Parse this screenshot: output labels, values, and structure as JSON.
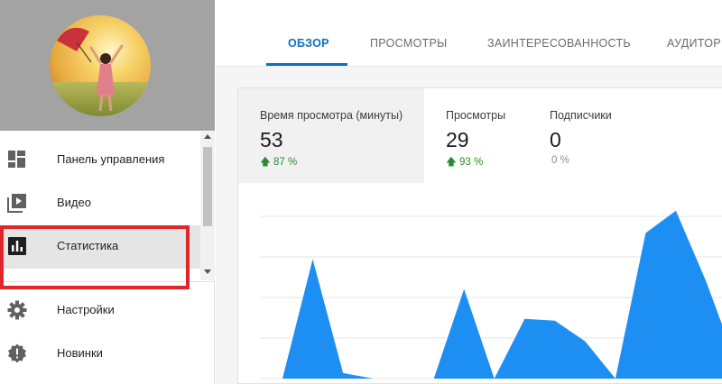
{
  "sidebar": {
    "items": [
      {
        "label": "Панель управления",
        "icon": "dashboard-icon"
      },
      {
        "label": "Видео",
        "icon": "video-library-icon"
      },
      {
        "label": "Статистика",
        "icon": "analytics-icon"
      },
      {
        "label": "Настройки",
        "icon": "gear-icon"
      },
      {
        "label": "Новинки",
        "icon": "alert-badge-icon"
      }
    ],
    "active_item": "Статистика"
  },
  "tabs": [
    {
      "label": "ОБЗОР"
    },
    {
      "label": "ПРОСМОТРЫ"
    },
    {
      "label": "ЗАИНТЕРЕСОВАННОСТЬ"
    },
    {
      "label": "АУДИТОР"
    }
  ],
  "metrics": [
    {
      "label": "Время просмотра (минуты)",
      "value": "53",
      "change": "87 %",
      "trend": "up"
    },
    {
      "label": "Просмотры",
      "value": "29",
      "change": "93 %",
      "trend": "up"
    },
    {
      "label": "Подписчики",
      "value": "0",
      "change": "0 %",
      "trend": "flat"
    }
  ],
  "colors": {
    "accent": "#0b6fc4",
    "chart_fill": "#1e8ff2",
    "positive": "#2e8b2e",
    "highlight": "#e0262b"
  },
  "chart_data": {
    "type": "area",
    "x": [
      0,
      1,
      2,
      3,
      4,
      5,
      6,
      7,
      8,
      9,
      10,
      11,
      12,
      13,
      14,
      15
    ],
    "values": [
      0,
      3.2,
      0.15,
      0,
      0,
      0,
      2.4,
      0,
      1.6,
      1.55,
      1.0,
      0,
      3.9,
      4.5,
      2.6,
      0.4
    ],
    "ylim": [
      0,
      5
    ],
    "grid": true
  }
}
